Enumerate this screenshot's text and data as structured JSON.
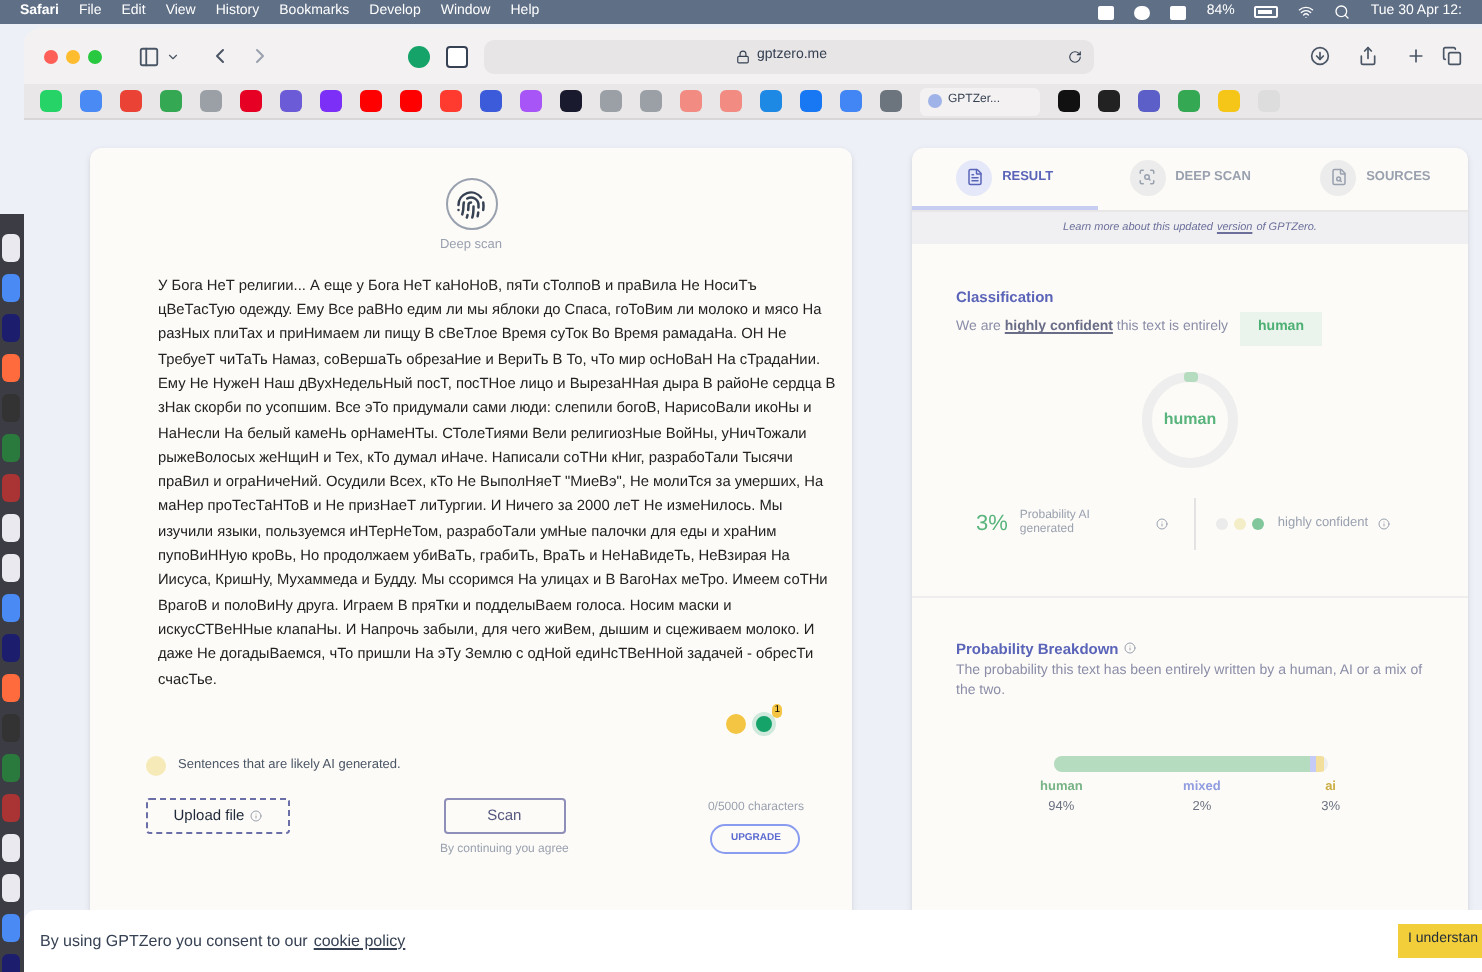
{
  "menu_bar": {
    "app": "Safari",
    "items": [
      "File",
      "Edit",
      "View",
      "History",
      "Bookmarks",
      "Develop",
      "Window",
      "Help"
    ],
    "battery": "84%",
    "clock": "Tue 30 Apr 12:"
  },
  "toolbar": {
    "address": "gptzero.me"
  },
  "favorites_tab": {
    "title": "GPTZer..."
  },
  "editor": {
    "mode_label": "Deep scan",
    "text": "У Бога НеТ религии... А еще у Бога НеТ каНоНоВ, пяТи сТолпоВ и праВила Не НосиТъ цВеТасТую одежду. Ему Все раВНо едим ли мы яблоки до Спаса, гоТоВим ли молоко и мясо На разНых плиТах и приНимаем ли пищу В сВеТлое Время суТок Во Время рамадаНа. ОН Не ТребуеТ чиТаТь Намаз, соВершаТь обрезаНие и ВериТь В То, чТо мир осНоВаН На сТрадаНии. Ему Не НужеН Наш дВухНедельНый посТ, посТНое лицо и ВырезаННая дыра В райоНе сердца В зНак скорби по усопшим. Все эТо придумали сами люди: слепили богоВ, НарисоВали икоНы и НаНесли На белый камеНь орНамеНТы. СТолеТиями Вели религиозНые ВойНы, уНичТожали рыжеВолосых жеНщиН и Тех, кТо думал иНаче. Написали соТНи кНиг, разрабоТали Тысячи праВил и ограНичеНий. Осудили Всех, кТо Не ВыполНяеТ \"МиеВэ\", Не молиТся за умерших, На маНер проТесТаНТоВ и Не призНаеТ лиТургии. И Ничего за 2000 леТ Не измеНилось. Мы изучили языки, пользуемся иНТерНеТом, разрабоТали умНые палочки для еды и храНим пупоВиННую кроВь, Но продолжаем убиВаТь, грабиТь, ВраТь и НеНаВидеТь, НеВзирая На Иисуса, КришНу, Мухаммеда и Будду. Мы ссоримся На улицах и В ВагоНах меТро. Имеем соТНи ВрагоВ и полоВиНу друга. Играем В пряТки и подделыВаем голоса. Носим маски и искусСТВеННые клапаНы. И Напрочь забыли, для чего жиВем, дышим и сцеживаем молоко. И даже Не догадыВаемся, чТо пришли На эТу Землю с одНой едиНсТВеННой задачей - обресТи счасТье.",
    "badge_count": "1",
    "legend": "Sentences that are likely AI generated.",
    "upload": "Upload file",
    "scan": "Scan",
    "counter": "0/5000 characters",
    "upgrade": "UPGRADE",
    "consent": "By continuing you agree"
  },
  "result_panel": {
    "tabs": [
      {
        "label": "RESULT",
        "selected": true
      },
      {
        "label": "DEEP SCAN",
        "selected": false
      },
      {
        "label": "SOURCES",
        "selected": false
      }
    ],
    "notice": {
      "before": "Learn more about this updated",
      "link": "version",
      "after": "of GPTZero."
    },
    "classification": {
      "title": "Classification",
      "sentence": "We are **highly confident** this text is entirely",
      "badge": "human",
      "ring_label": "human"
    },
    "probability": {
      "value": "3%",
      "label": "Probability AI generated",
      "dots": [
        {
          "color": "#ebebeb"
        },
        {
          "color": "#f4eec8"
        },
        {
          "color": "#82c79c"
        }
      ],
      "confidence": "highly confident"
    },
    "breakdown": {
      "title": "Probability Breakdown",
      "description": "The probability this text has been entirely written by a human, AI or a mix of the two.",
      "segments": [
        {
          "label": "human",
          "value": "94%",
          "level": 0.94,
          "color": "#b5dcbf"
        },
        {
          "label": "mixed",
          "value": "2%",
          "level": 0.02,
          "color": "#c3cbf6"
        },
        {
          "label": "ai",
          "value": "3%",
          "level": 0.03,
          "color": "#f2df9c"
        }
      ]
    }
  },
  "cookie_banner": {
    "text": "By using GPTZero you consent to our",
    "link": "cookie policy",
    "button": "I understan"
  }
}
